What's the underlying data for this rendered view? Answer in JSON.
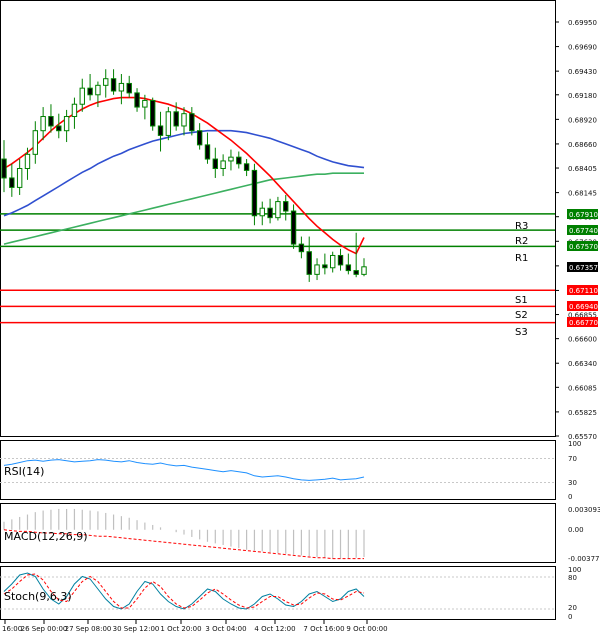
{
  "chart_data": {
    "type": "candlestick",
    "main": {
      "y_ticks": [
        "0.69950",
        "0.69690",
        "0.69430",
        "0.69180",
        "0.68920",
        "0.68660",
        "0.68405",
        "0.68145",
        "0.67890",
        "0.67630",
        "0.67370",
        "0.67110",
        "0.66855",
        "0.66600",
        "0.66340",
        "0.66085",
        "0.65825",
        "0.65570"
      ],
      "ylim": [
        0.6557,
        0.7015
      ],
      "current_price": "0.67357",
      "candles": [
        {
          "o": 0.685,
          "h": 0.687,
          "l": 0.6815,
          "c": 0.683
        },
        {
          "o": 0.683,
          "h": 0.6845,
          "l": 0.681,
          "c": 0.682
        },
        {
          "o": 0.682,
          "h": 0.685,
          "l": 0.6812,
          "c": 0.684
        },
        {
          "o": 0.684,
          "h": 0.6862,
          "l": 0.6828,
          "c": 0.6855
        },
        {
          "o": 0.6855,
          "h": 0.689,
          "l": 0.6845,
          "c": 0.688
        },
        {
          "o": 0.688,
          "h": 0.6905,
          "l": 0.687,
          "c": 0.6895
        },
        {
          "o": 0.6895,
          "h": 0.6908,
          "l": 0.6878,
          "c": 0.6885
        },
        {
          "o": 0.6885,
          "h": 0.6898,
          "l": 0.6872,
          "c": 0.688
        },
        {
          "o": 0.688,
          "h": 0.6902,
          "l": 0.6868,
          "c": 0.6895
        },
        {
          "o": 0.6895,
          "h": 0.6915,
          "l": 0.6882,
          "c": 0.6908
        },
        {
          "o": 0.6908,
          "h": 0.6935,
          "l": 0.69,
          "c": 0.6925
        },
        {
          "o": 0.6925,
          "h": 0.694,
          "l": 0.6912,
          "c": 0.6918
        },
        {
          "o": 0.6918,
          "h": 0.6932,
          "l": 0.6905,
          "c": 0.6928
        },
        {
          "o": 0.6928,
          "h": 0.6945,
          "l": 0.6915,
          "c": 0.6935
        },
        {
          "o": 0.6935,
          "h": 0.6945,
          "l": 0.6918,
          "c": 0.6922
        },
        {
          "o": 0.6922,
          "h": 0.694,
          "l": 0.6908,
          "c": 0.693
        },
        {
          "o": 0.693,
          "h": 0.6938,
          "l": 0.6915,
          "c": 0.692
        },
        {
          "o": 0.692,
          "h": 0.6925,
          "l": 0.69,
          "c": 0.6905
        },
        {
          "o": 0.6905,
          "h": 0.6918,
          "l": 0.6892,
          "c": 0.6912
        },
        {
          "o": 0.6912,
          "h": 0.6915,
          "l": 0.688,
          "c": 0.6885
        },
        {
          "o": 0.6885,
          "h": 0.69,
          "l": 0.6858,
          "c": 0.6875
        },
        {
          "o": 0.6875,
          "h": 0.6905,
          "l": 0.687,
          "c": 0.69
        },
        {
          "o": 0.69,
          "h": 0.691,
          "l": 0.688,
          "c": 0.6885
        },
        {
          "o": 0.6885,
          "h": 0.6905,
          "l": 0.6875,
          "c": 0.6898
        },
        {
          "o": 0.6898,
          "h": 0.6905,
          "l": 0.6875,
          "c": 0.688
        },
        {
          "o": 0.688,
          "h": 0.6888,
          "l": 0.686,
          "c": 0.6865
        },
        {
          "o": 0.6865,
          "h": 0.6878,
          "l": 0.6845,
          "c": 0.685
        },
        {
          "o": 0.685,
          "h": 0.6862,
          "l": 0.683,
          "c": 0.684
        },
        {
          "o": 0.684,
          "h": 0.6855,
          "l": 0.6832,
          "c": 0.6848
        },
        {
          "o": 0.6848,
          "h": 0.686,
          "l": 0.6838,
          "c": 0.6852
        },
        {
          "o": 0.6852,
          "h": 0.6858,
          "l": 0.684,
          "c": 0.6845
        },
        {
          "o": 0.6845,
          "h": 0.685,
          "l": 0.6832,
          "c": 0.6838
        },
        {
          "o": 0.6838,
          "h": 0.6845,
          "l": 0.678,
          "c": 0.679
        },
        {
          "o": 0.679,
          "h": 0.6805,
          "l": 0.678,
          "c": 0.6798
        },
        {
          "o": 0.6798,
          "h": 0.6808,
          "l": 0.6782,
          "c": 0.6788
        },
        {
          "o": 0.6788,
          "h": 0.681,
          "l": 0.6785,
          "c": 0.6805
        },
        {
          "o": 0.6805,
          "h": 0.6812,
          "l": 0.6785,
          "c": 0.6795
        },
        {
          "o": 0.6795,
          "h": 0.6802,
          "l": 0.6755,
          "c": 0.676
        },
        {
          "o": 0.676,
          "h": 0.6768,
          "l": 0.6745,
          "c": 0.6752
        },
        {
          "o": 0.6752,
          "h": 0.6768,
          "l": 0.672,
          "c": 0.6728
        },
        {
          "o": 0.6728,
          "h": 0.6745,
          "l": 0.6722,
          "c": 0.6738
        },
        {
          "o": 0.6738,
          "h": 0.675,
          "l": 0.6728,
          "c": 0.6735
        },
        {
          "o": 0.6735,
          "h": 0.6752,
          "l": 0.673,
          "c": 0.6748
        },
        {
          "o": 0.6748,
          "h": 0.6755,
          "l": 0.6732,
          "c": 0.6738
        },
        {
          "o": 0.6738,
          "h": 0.675,
          "l": 0.6728,
          "c": 0.6732
        },
        {
          "o": 0.6732,
          "h": 0.6772,
          "l": 0.6725,
          "c": 0.6728
        },
        {
          "o": 0.6728,
          "h": 0.6745,
          "l": 0.6726,
          "c": 0.6736
        }
      ],
      "ma_fast_red": [
        0.684,
        0.6845,
        0.6851,
        0.6857,
        0.6864,
        0.6872,
        0.688,
        0.6887,
        0.6893,
        0.6898,
        0.6903,
        0.6907,
        0.691,
        0.6912,
        0.6914,
        0.6915,
        0.6915,
        0.6915,
        0.6914,
        0.6912,
        0.691,
        0.6908,
        0.6905,
        0.6902,
        0.6898,
        0.6893,
        0.6888,
        0.6882,
        0.6876,
        0.687,
        0.6863,
        0.6856,
        0.6848,
        0.684,
        0.6832,
        0.6823,
        0.6814,
        0.6805,
        0.6796,
        0.6787,
        0.6779,
        0.6772,
        0.6765,
        0.6759,
        0.6754,
        0.675,
        0.6767
      ],
      "ma_mid_blue": [
        0.679,
        0.6793,
        0.6797,
        0.6801,
        0.6806,
        0.6811,
        0.6816,
        0.6821,
        0.6826,
        0.6831,
        0.6836,
        0.684,
        0.6845,
        0.6849,
        0.6853,
        0.6856,
        0.686,
        0.6863,
        0.6866,
        0.6869,
        0.6871,
        0.6873,
        0.6875,
        0.6877,
        0.6878,
        0.6879,
        0.688,
        0.688,
        0.688,
        0.688,
        0.6879,
        0.6878,
        0.6876,
        0.6874,
        0.6872,
        0.6869,
        0.6866,
        0.6863,
        0.686,
        0.6857,
        0.6853,
        0.685,
        0.6847,
        0.6845,
        0.6843,
        0.6842,
        0.6841
      ],
      "ma_slow_green": [
        0.676,
        0.6762,
        0.6764,
        0.6766,
        0.6768,
        0.677,
        0.6772,
        0.6774,
        0.6776,
        0.6778,
        0.678,
        0.6782,
        0.6784,
        0.6786,
        0.6788,
        0.679,
        0.6792,
        0.6794,
        0.6796,
        0.6798,
        0.68,
        0.6802,
        0.6804,
        0.6806,
        0.6808,
        0.681,
        0.6812,
        0.6814,
        0.6816,
        0.6818,
        0.682,
        0.6822,
        0.6824,
        0.6826,
        0.6828,
        0.6829,
        0.683,
        0.6831,
        0.6832,
        0.6833,
        0.6834,
        0.6834,
        0.6835,
        0.6835,
        0.6835,
        0.6835,
        0.6835
      ],
      "levels": [
        {
          "name": "R3",
          "value": 0.6791,
          "label": "0.67910",
          "color": "#008000",
          "box": "#008000"
        },
        {
          "name": "R2",
          "value": 0.6774,
          "label": "0.67740",
          "color": "#008000",
          "box": "#008000"
        },
        {
          "name": "R1",
          "value": 0.6757,
          "label": "0.67570",
          "color": "#008000",
          "box": "#008000"
        },
        {
          "name": "S1",
          "value": 0.6711,
          "label": "0.67110",
          "color": "#ff0000",
          "box": "#ff0000"
        },
        {
          "name": "S2",
          "value": 0.6694,
          "label": "0.66940",
          "color": "#ff0000",
          "box": "#ff0000"
        },
        {
          "name": "S3",
          "value": 0.6677,
          "label": "0.66770",
          "color": "#ff0000",
          "box": "#ff0000"
        }
      ]
    },
    "x_ticks": [
      "16:00",
      "26 Sep 00:00",
      "27 Sep 08:00",
      "30 Sep 12:00",
      "1 Oct 20:00",
      "3 Oct 04:00",
      "4 Oct 12:00",
      "7 Oct 16:00",
      "9 Oct 00:00"
    ],
    "rsi": {
      "label": "RSI(14)",
      "levels": [
        "100",
        "70",
        "30",
        "0"
      ],
      "ylim": [
        0,
        100
      ],
      "values": [
        58,
        60,
        63,
        66,
        67,
        65,
        67,
        68,
        66,
        64,
        65,
        66,
        68,
        67,
        65,
        64,
        66,
        63,
        61,
        60,
        62,
        59,
        57,
        58,
        55,
        53,
        51,
        49,
        47,
        49,
        47,
        45,
        40,
        38,
        39,
        40,
        38,
        35,
        33,
        32,
        33,
        34,
        36,
        33,
        34,
        35,
        38
      ]
    },
    "macd": {
      "label": "MACD(12,26,9)",
      "ticks": [
        "0.003093",
        "0.00",
        "-0.003776"
      ],
      "ylim": [
        -0.003776,
        0.003093
      ],
      "histogram": [
        0.001,
        0.0013,
        0.0016,
        0.0019,
        0.0022,
        0.0024,
        0.0025,
        0.0026,
        0.0026,
        0.0026,
        0.0025,
        0.0024,
        0.0023,
        0.0021,
        0.0019,
        0.0017,
        0.0015,
        0.0012,
        0.0009,
        0.0006,
        0.0003,
        0.0,
        -0.0003,
        -0.0006,
        -0.0009,
        -0.0012,
        -0.0015,
        -0.0017,
        -0.0019,
        -0.0021,
        -0.0023,
        -0.0025,
        -0.0026,
        -0.0027,
        -0.0028,
        -0.0029,
        -0.003,
        -0.0031,
        -0.0032,
        -0.0033,
        -0.0034,
        -0.0035,
        -0.0036,
        -0.0036,
        -0.0036,
        -0.0035,
        -0.0034
      ],
      "signal": [
        0.0,
        -0.0001,
        -0.0002,
        -0.0002,
        -0.0003,
        -0.0004,
        -0.0004,
        -0.0005,
        -0.0005,
        -0.0006,
        -0.0006,
        -0.0007,
        -0.0008,
        -0.0008,
        -0.0009,
        -0.001,
        -0.0011,
        -0.0012,
        -0.0013,
        -0.0014,
        -0.0015,
        -0.0016,
        -0.0017,
        -0.0018,
        -0.0019,
        -0.002,
        -0.0021,
        -0.0022,
        -0.0023,
        -0.0024,
        -0.0025,
        -0.0026,
        -0.0027,
        -0.0028,
        -0.0029,
        -0.003,
        -0.0031,
        -0.0032,
        -0.0033,
        -0.0034,
        -0.0035,
        -0.0035,
        -0.0036,
        -0.0036,
        -0.0036,
        -0.0036,
        -0.0036
      ]
    },
    "stoch": {
      "label": "Stoch(9,6,3)",
      "ticks": [
        "100",
        "80",
        "20",
        "0"
      ],
      "ylim": [
        0,
        100
      ],
      "main": [
        55,
        70,
        88,
        92,
        85,
        60,
        40,
        30,
        45,
        70,
        85,
        80,
        60,
        40,
        25,
        20,
        30,
        55,
        75,
        70,
        50,
        35,
        25,
        20,
        30,
        45,
        60,
        55,
        40,
        30,
        22,
        20,
        30,
        45,
        50,
        40,
        28,
        25,
        35,
        50,
        55,
        45,
        35,
        40,
        55,
        60,
        45
      ],
      "signal": [
        50,
        60,
        75,
        88,
        90,
        78,
        55,
        38,
        35,
        55,
        75,
        85,
        75,
        55,
        35,
        22,
        22,
        40,
        62,
        75,
        65,
        45,
        30,
        22,
        25,
        38,
        52,
        60,
        50,
        38,
        28,
        22,
        24,
        35,
        45,
        45,
        35,
        28,
        30,
        42,
        52,
        50,
        40,
        38,
        46,
        55,
        52
      ]
    }
  },
  "colors": {
    "candle": "#008000",
    "ma_fast": "#ff0000",
    "ma_mid": "#3050d0",
    "ma_slow": "#3cb060",
    "rsi_line": "#1e90ff",
    "macd_hist": "#c0c0c0",
    "macd_signal": "#ff0000",
    "stoch_main": "#0080a0",
    "stoch_signal": "#ff0000",
    "price_box": "#000000"
  }
}
